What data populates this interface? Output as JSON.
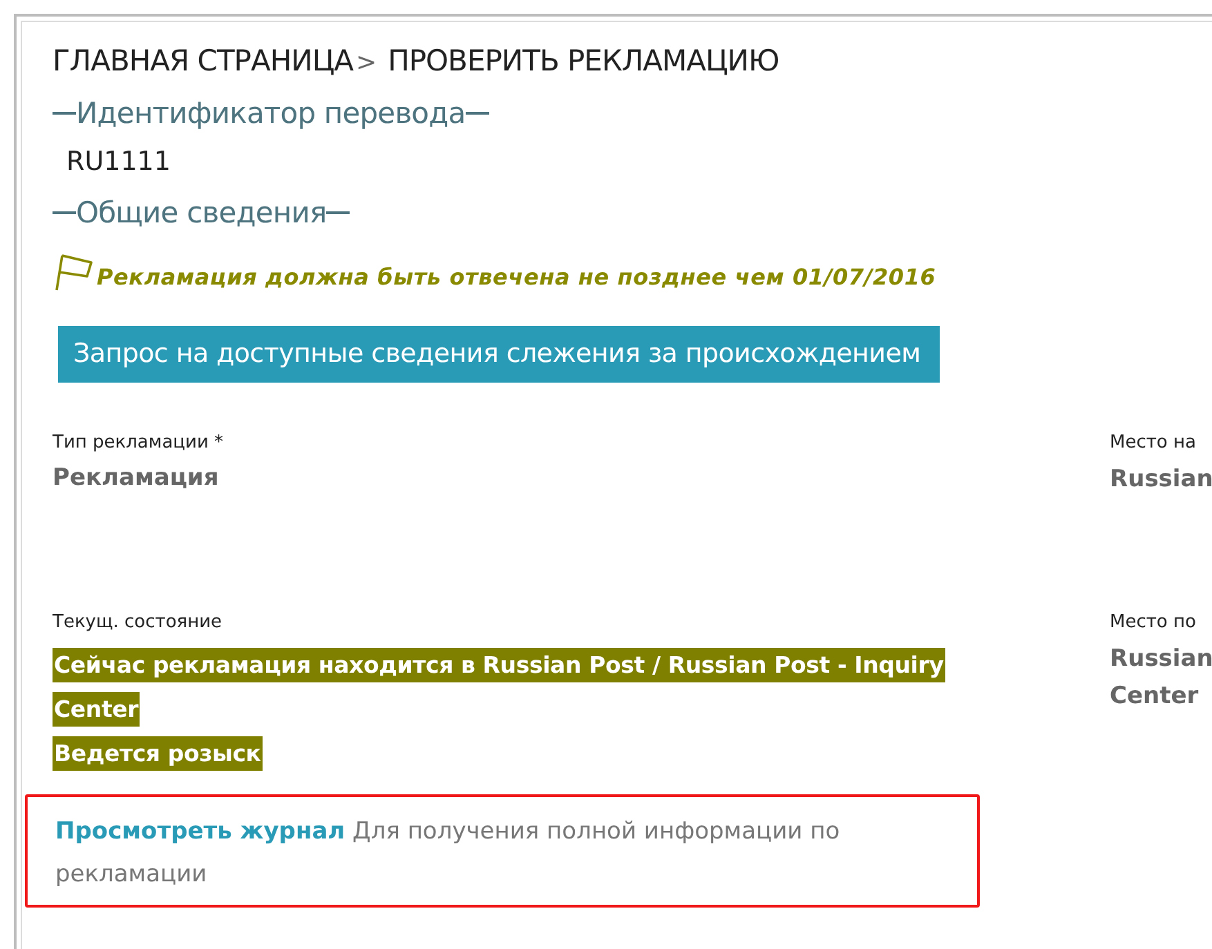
{
  "breadcrumb": {
    "home": "ГЛАВНАЯ СТРАНИЦА",
    "separator": ">",
    "current": "ПРОВЕРИТЬ РЕКЛАМАЦИЮ"
  },
  "transfer_id": {
    "legend": "Идентификатор перевода",
    "value": "RU1111"
  },
  "general": {
    "legend": "Общие сведения",
    "deadline": "Рекламация должна быть отвечена не позднее чем 01/07/2016",
    "tracking_button": "Запрос на доступные сведения слежения за происхождением",
    "rows": [
      {
        "left": {
          "label": "Тип рекламации *",
          "kind": "plain",
          "values": [
            "Рекламация"
          ]
        },
        "right": {
          "label": "Место на",
          "values": [
            "Russian"
          ]
        }
      },
      {
        "left": {
          "label": "Текущ. состояние",
          "kind": "status",
          "values": [
            "Сейчас рекламация находится в Russian Post / Russian Post - Inquiry",
            "Center",
            "Ведется розыск"
          ]
        },
        "right": {
          "label": "Место по",
          "values": [
            "Russian",
            "Center"
          ]
        }
      }
    ],
    "log_note": {
      "link": "Просмотреть журнал",
      "text": "Для получения полной информации по рекламации",
      "highlighted": true
    }
  }
}
